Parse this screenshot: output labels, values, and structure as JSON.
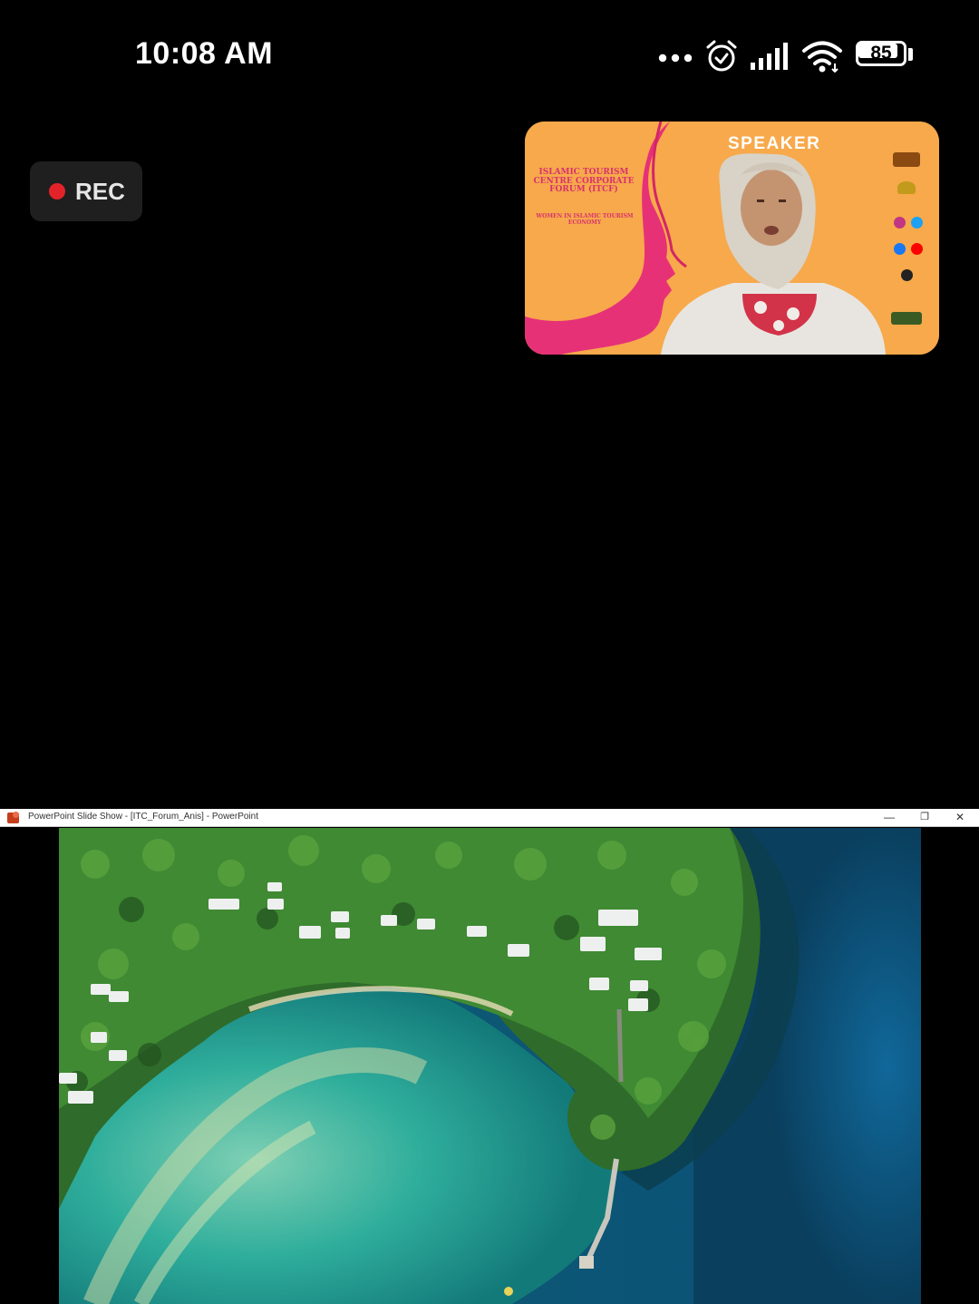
{
  "status_bar": {
    "time": "10:08 AM",
    "battery_level": 85,
    "battery_text": "85",
    "icons": [
      "more-dots-icon",
      "alarm-icon",
      "signal-icon",
      "wifi-icon",
      "battery-icon"
    ]
  },
  "recording": {
    "label": "REC",
    "dot_color": "#e3232a"
  },
  "speaker_video": {
    "tag": "SPEAKER",
    "slide_title": "ISLAMIC TOURISM CENTRE CORPORATE FORUM (ITCF)",
    "slide_subtitle": "WOMEN IN ISLAMIC TOURISM ECONOMY",
    "background_color": "#f7a94b",
    "accent_color": "#e63177"
  },
  "ppt_window": {
    "title": "PowerPoint Slide Show - [ITC_Forum_Anis] - PowerPoint",
    "minimize_label": "—",
    "restore_label": "❐",
    "close_label": "✕",
    "slide_content": "aerial-island-resort-photo"
  }
}
